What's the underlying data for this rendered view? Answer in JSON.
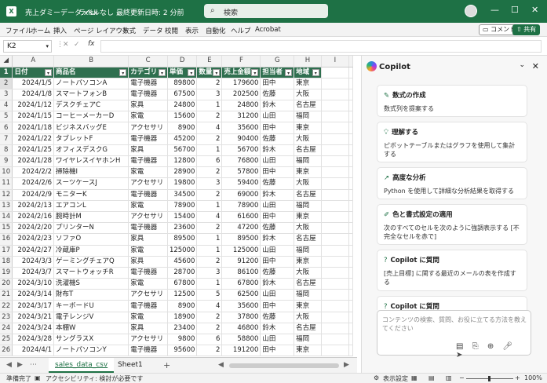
{
  "window": {
    "file_name": "売上ダミーデータ.xlsx",
    "sensitivity": "ラベルなし",
    "last_modified": "最終更新日時: 2 分前",
    "search_placeholder": "検索"
  },
  "ribbon": {
    "tabs": [
      "ファイル",
      "ホーム",
      "挿入",
      "ページ レイアウト",
      "数式",
      "データ",
      "校閲",
      "表示",
      "自動化",
      "ヘルプ",
      "Acrobat"
    ],
    "comment_label": "コメント",
    "share_label": "共有"
  },
  "formula_bar": {
    "name_box": "K2",
    "formula": ""
  },
  "grid": {
    "columns": [
      "A",
      "B",
      "C",
      "D",
      "E",
      "F",
      "G",
      "H",
      "I"
    ],
    "header": [
      "日付",
      "商品名",
      "カテゴリ",
      "単価",
      "数量",
      "売上金額",
      "担当者",
      "地域"
    ],
    "rows": [
      [
        "2024/1/5",
        "ノートパソコンA",
        "電子機器",
        "89800",
        "2",
        "179600",
        "田中",
        "東京"
      ],
      [
        "2024/1/8",
        "スマートフォンB",
        "電子機器",
        "67500",
        "3",
        "202500",
        "佐藤",
        "大阪"
      ],
      [
        "2024/1/12",
        "デスクチェアC",
        "家具",
        "24800",
        "1",
        "24800",
        "鈴木",
        "名古屋"
      ],
      [
        "2024/1/15",
        "コーヒーメーカーD",
        "家電",
        "15600",
        "2",
        "31200",
        "山田",
        "福岡"
      ],
      [
        "2024/1/18",
        "ビジネスバッグE",
        "アクセサリ",
        "8900",
        "4",
        "35600",
        "田中",
        "東京"
      ],
      [
        "2024/1/22",
        "タブレットF",
        "電子機器",
        "45200",
        "2",
        "90400",
        "佐藤",
        "大阪"
      ],
      [
        "2024/1/25",
        "オフィスデスクG",
        "家具",
        "56700",
        "1",
        "56700",
        "鈴木",
        "名古屋"
      ],
      [
        "2024/1/28",
        "ワイヤレスイヤホンH",
        "電子機器",
        "12800",
        "6",
        "76800",
        "山田",
        "福岡"
      ],
      [
        "2024/2/2",
        "掃除機I",
        "家電",
        "28900",
        "2",
        "57800",
        "田中",
        "東京"
      ],
      [
        "2024/2/6",
        "スーツケースJ",
        "アクセサリ",
        "19800",
        "3",
        "59400",
        "佐藤",
        "大阪"
      ],
      [
        "2024/2/9",
        "モニターK",
        "電子機器",
        "34500",
        "2",
        "69000",
        "鈴木",
        "名古屋"
      ],
      [
        "2024/2/13",
        "エアコンL",
        "家電",
        "78900",
        "1",
        "78900",
        "山田",
        "福岡"
      ],
      [
        "2024/2/16",
        "腕時計M",
        "アクセサリ",
        "15400",
        "4",
        "61600",
        "田中",
        "東京"
      ],
      [
        "2024/2/20",
        "プリンターN",
        "電子機器",
        "23600",
        "2",
        "47200",
        "佐藤",
        "大阪"
      ],
      [
        "2024/2/23",
        "ソファO",
        "家具",
        "89500",
        "1",
        "89500",
        "鈴木",
        "名古屋"
      ],
      [
        "2024/2/27",
        "冷蔵庫P",
        "家電",
        "125000",
        "1",
        "125000",
        "山田",
        "福岡"
      ],
      [
        "2024/3/3",
        "ゲーミングチェアQ",
        "家具",
        "45600",
        "2",
        "91200",
        "田中",
        "東京"
      ],
      [
        "2024/3/7",
        "スマートウォッチR",
        "電子機器",
        "28700",
        "3",
        "86100",
        "佐藤",
        "大阪"
      ],
      [
        "2024/3/10",
        "洗濯機S",
        "家電",
        "67800",
        "1",
        "67800",
        "鈴木",
        "名古屋"
      ],
      [
        "2024/3/14",
        "財布T",
        "アクセサリ",
        "12500",
        "5",
        "62500",
        "山田",
        "福岡"
      ],
      [
        "2024/3/17",
        "キーボードU",
        "電子機器",
        "8900",
        "4",
        "35600",
        "田中",
        "東京"
      ],
      [
        "2024/3/21",
        "電子レンジV",
        "家電",
        "18900",
        "2",
        "37800",
        "佐藤",
        "大阪"
      ],
      [
        "2024/3/24",
        "本棚W",
        "家具",
        "23400",
        "2",
        "46800",
        "鈴木",
        "名古屋"
      ],
      [
        "2024/3/28",
        "サングラスX",
        "アクセサリ",
        "9800",
        "6",
        "58800",
        "山田",
        "福岡"
      ],
      [
        "2024/4/1",
        "ノートパソコンY",
        "電子機器",
        "95600",
        "2",
        "191200",
        "田中",
        "東京"
      ]
    ]
  },
  "sheets": {
    "tabs": [
      "sales_data_csv",
      "Sheet1"
    ],
    "active": 0
  },
  "status": {
    "ready": "準備完了",
    "accessibility": "アクセシビリティ: 検討が必要です",
    "display_settings": "表示設定",
    "zoom": "100%"
  },
  "copilot": {
    "title": "Copilot",
    "cards": [
      {
        "icon": "pencil-icon",
        "title": "数式の作成",
        "desc": "数式列を提案する"
      },
      {
        "icon": "lightbulb-icon",
        "title": "理解する",
        "desc": "ピボットテーブルまたはグラフを使用して集計する"
      },
      {
        "icon": "chart-icon",
        "title": "高度な分析",
        "desc": "Python を使用して詳細な分析結果を取得する"
      },
      {
        "icon": "brush-icon",
        "title": "色と書式設定の適用",
        "desc": "次のすべてのセルを次のように強調表示する [不完全なセルを赤で]"
      },
      {
        "icon": "question-icon",
        "title": "Copilot に質問",
        "desc": "[売上目標] に関する最近のメールの表を作成する"
      },
      {
        "icon": "question-icon",
        "title": "Copilot に質問",
        "desc": ""
      }
    ],
    "compose_placeholder": "コンテンツの検索、質問、お役に立てる方法を教えてください"
  }
}
